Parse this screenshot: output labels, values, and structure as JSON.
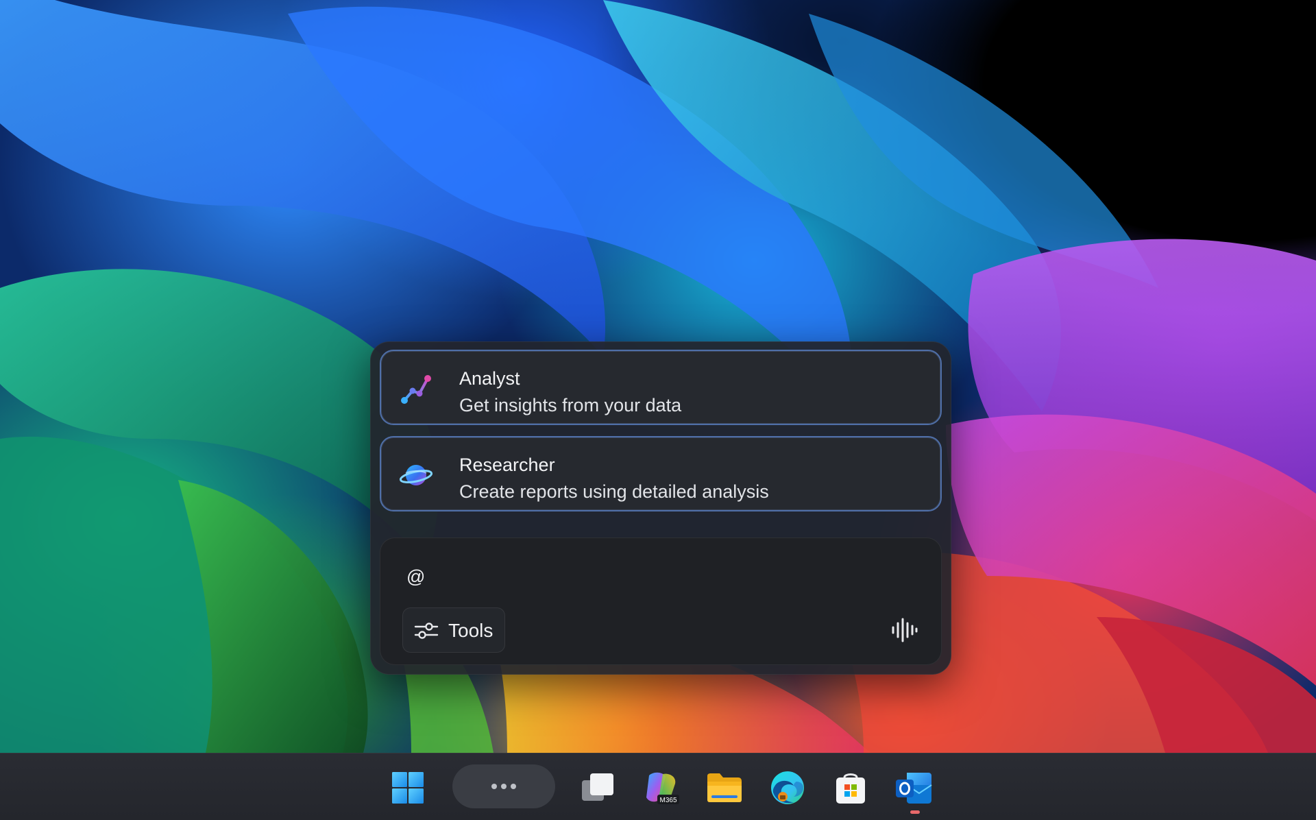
{
  "colors": {
    "popup_bg": "#22252c",
    "card_border": "#4f6fa8",
    "text_primary": "#f2f3f5",
    "taskbar_bg": "#2a2c33",
    "running_indicator": "#e6686a"
  },
  "popup": {
    "agents": [
      {
        "title": "Analyst",
        "description": "Get insights from your data",
        "icon": "analyst-chart-icon"
      },
      {
        "title": "Researcher",
        "description": "Create reports using detailed analysis",
        "icon": "researcher-planet-icon"
      }
    ],
    "compose": {
      "value": "@",
      "tools_label": "Tools",
      "tools_icon": "sliders-icon",
      "voice_icon": "voice-waveform-icon"
    }
  },
  "taskbar": {
    "items": [
      {
        "name": "start",
        "icon": "windows-logo-icon"
      },
      {
        "name": "search-pill",
        "icon": "more-dots-icon"
      },
      {
        "name": "task-view",
        "icon": "task-view-icon"
      },
      {
        "name": "m365-copilot",
        "icon": "m365-copilot-icon",
        "badge": "M365"
      },
      {
        "name": "file-explorer",
        "icon": "folder-icon"
      },
      {
        "name": "edge",
        "icon": "edge-browser-icon"
      },
      {
        "name": "store",
        "icon": "store-bag-icon"
      },
      {
        "name": "outlook",
        "icon": "outlook-icon",
        "running": true
      }
    ]
  }
}
